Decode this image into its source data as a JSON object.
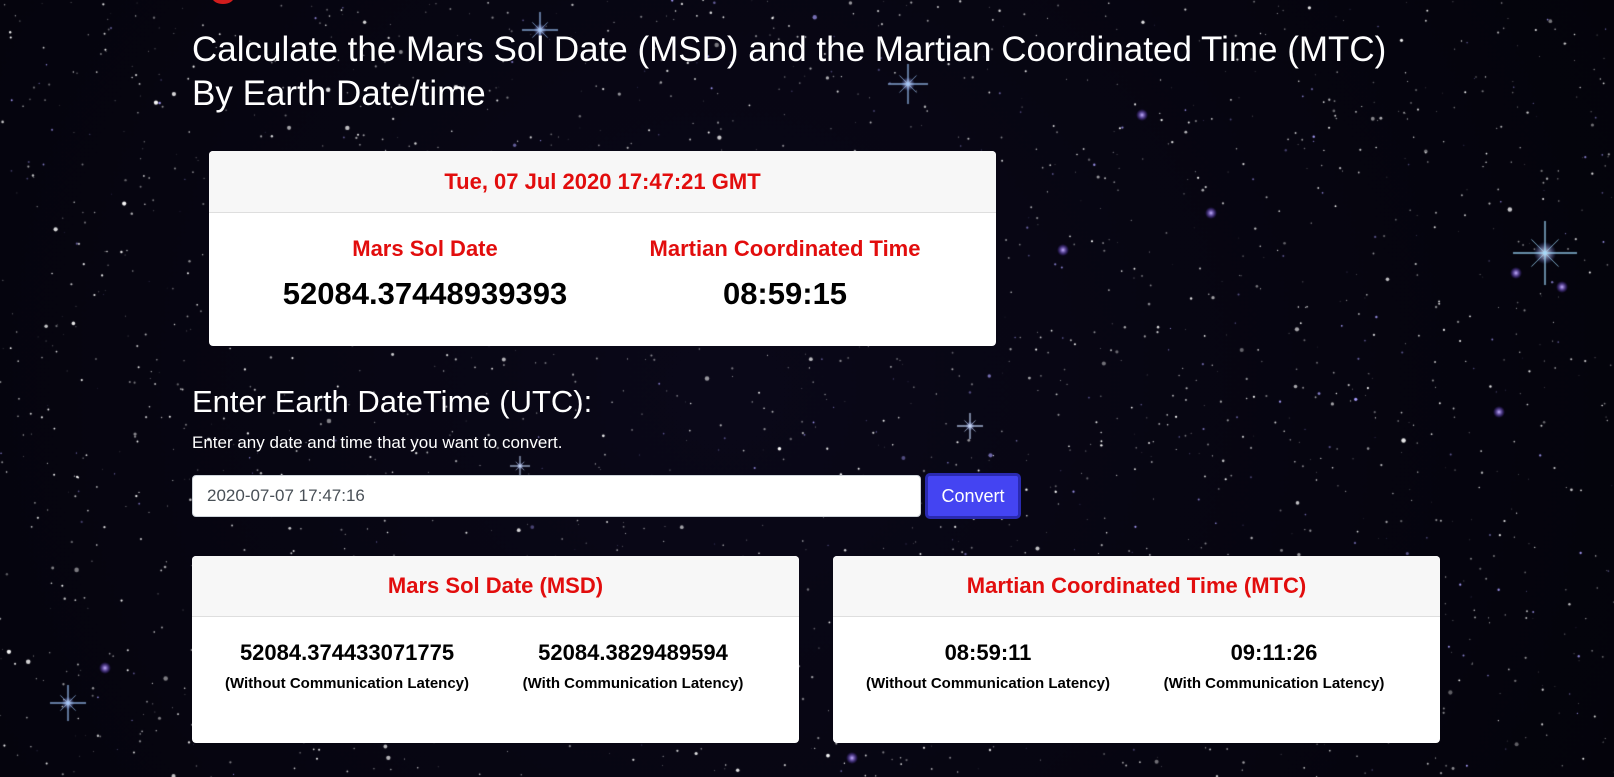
{
  "page": {
    "title_line1": "Calculate the Mars Sol Date (MSD) and the Martian Coordinated Time (MTC)",
    "title_line2": "By Earth Date/time"
  },
  "current": {
    "timestamp": "Tue, 07 Jul 2020 17:47:21 GMT",
    "msd_label": "Mars Sol Date",
    "msd_value": "52084.37448939393",
    "mtc_label": "Martian Coordinated Time",
    "mtc_value": "08:59:15"
  },
  "converter": {
    "heading": "Enter Earth DateTime (UTC):",
    "hint": "Enter any date and time that you want to convert.",
    "input_value": "2020-07-07 17:47:16",
    "button_label": "Convert"
  },
  "results": {
    "msd": {
      "title": "Mars Sol Date (MSD)",
      "without_value": "52084.374433071775",
      "without_label": "(Without Communication Latency)",
      "with_value": "52084.3829489594",
      "with_label": "(With Communication Latency)"
    },
    "mtc": {
      "title": "Martian Coordinated Time (MTC)",
      "without_value": "08:59:11",
      "without_label": "(Without Communication Latency)",
      "with_value": "09:11:26",
      "with_label": "(With Communication Latency)"
    }
  },
  "colors": {
    "accent_red": "#e20d0d",
    "button_blue": "#4444f2",
    "background": "#05040c"
  }
}
